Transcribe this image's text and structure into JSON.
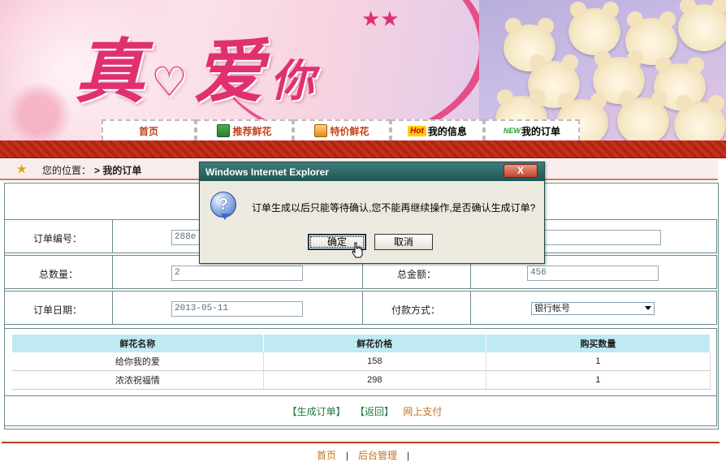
{
  "banner": {
    "logo_text_main": "真",
    "logo_text_big": "爱",
    "logo_text_small": "你",
    "stars": "★★"
  },
  "nav": {
    "items": [
      {
        "label": "首页",
        "icon": "none"
      },
      {
        "label": "推荐鲜花",
        "icon": "gift-icon"
      },
      {
        "label": "特价鲜花",
        "icon": "bag-icon"
      },
      {
        "label": "我的信息",
        "badge": "Hot"
      },
      {
        "label": "我的订单",
        "badge": "NEW"
      }
    ]
  },
  "breadcrumb": {
    "prefix": "您的位置：",
    "arrow": ">",
    "current": "我的订单"
  },
  "order": {
    "order_no_label": "订单编号：",
    "order_no_value": "288e",
    "total_qty_label": "总数量：",
    "total_qty_value": "2",
    "total_amount_label": "总金额：",
    "total_amount_value": "456",
    "order_date_label": "订单日期：",
    "order_date_value": "2013-05-11",
    "payment_label": "付款方式：",
    "payment_value": "银行帐号"
  },
  "items_table": {
    "headers": [
      "鲜花名称",
      "鲜花价格",
      "购买数量"
    ],
    "rows": [
      [
        "给你我的爱",
        "158",
        "1"
      ],
      [
        "浓浓祝福情",
        "298",
        "1"
      ]
    ]
  },
  "actions": {
    "generate": "【生成订单】",
    "back": "【返回】",
    "pay_online": "网上支付"
  },
  "footer": {
    "home": "首页",
    "admin": "后台管理",
    "sep": "|"
  },
  "dialog": {
    "title": "Windows Internet Explorer",
    "close": "X",
    "message": "订单生成以后只能等待确认,您不能再继续操作,是否确认生成订单?",
    "ok": "确定",
    "cancel": "取消",
    "icon": "question-icon"
  },
  "colors": {
    "accent_red": "#c7301e",
    "title_teal": "#1f5654",
    "link_green": "#1f7a3d",
    "link_orange": "#c6711a"
  }
}
